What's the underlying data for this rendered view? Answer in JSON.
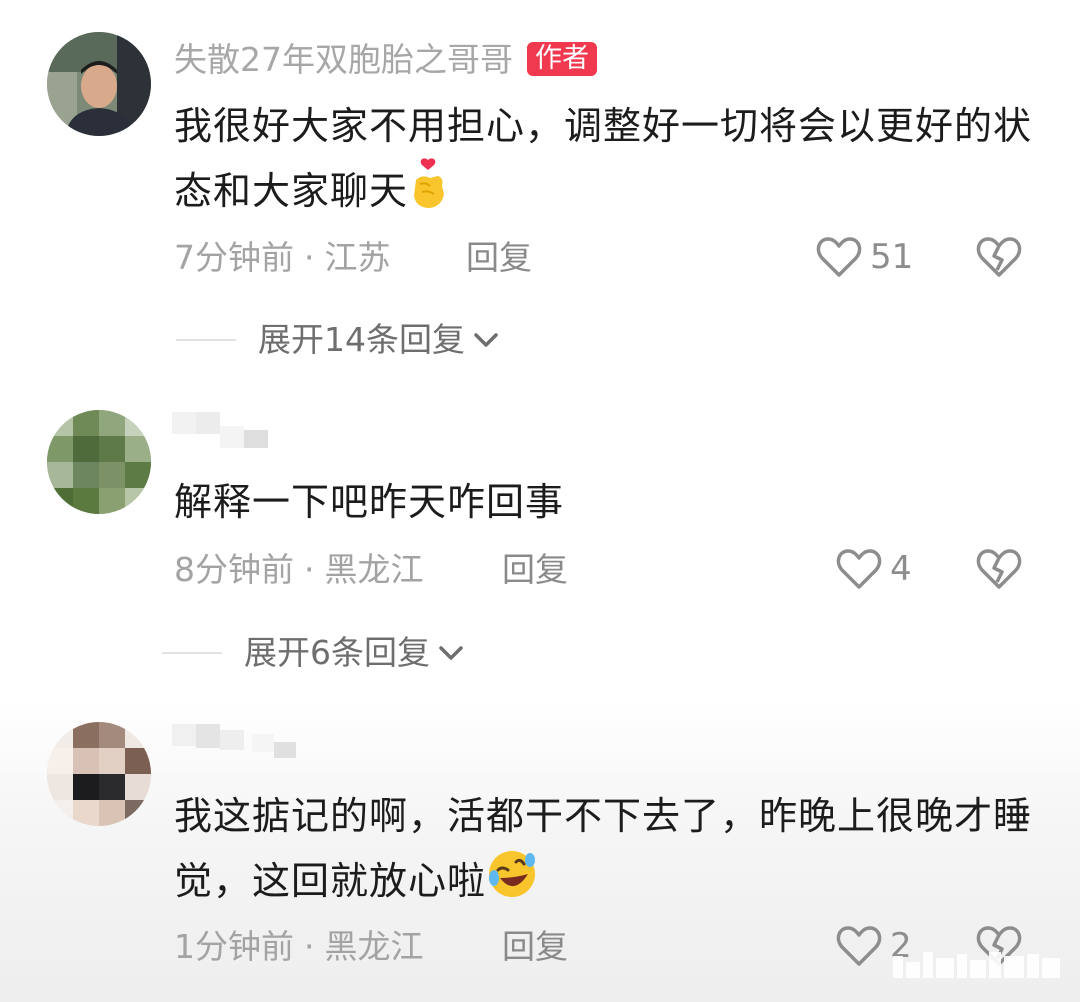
{
  "comments": [
    {
      "username": "失散27年双胞胎之哥哥",
      "badge": "作者",
      "text": "我很好大家不用担心，调整好一切将会以更好的状态和大家聊天",
      "emoji": "finger-heart-emoji",
      "time": "7分钟前",
      "location": "江苏",
      "reply_label": "回复",
      "likes": "51",
      "expand_label": "展开14条回复"
    },
    {
      "username": "",
      "text": "解释一下吧昨天咋回事",
      "time": "8分钟前",
      "location": "黑龙江",
      "reply_label": "回复",
      "likes": "4",
      "expand_label": "展开6条回复"
    },
    {
      "username": "",
      "text": "我这掂记的啊，活都干不下去了，昨晚上很晚才睡觉，这回就放心啦",
      "emoji": "rofl-emoji",
      "time": "1分钟前",
      "location": "黑龙江",
      "reply_label": "回复",
      "likes": "2"
    }
  ],
  "meta_separator": "·",
  "colors": {
    "badge_bg": "#f0384f",
    "meta_text": "#a3a3a3",
    "content_text": "#1c1c1c"
  }
}
